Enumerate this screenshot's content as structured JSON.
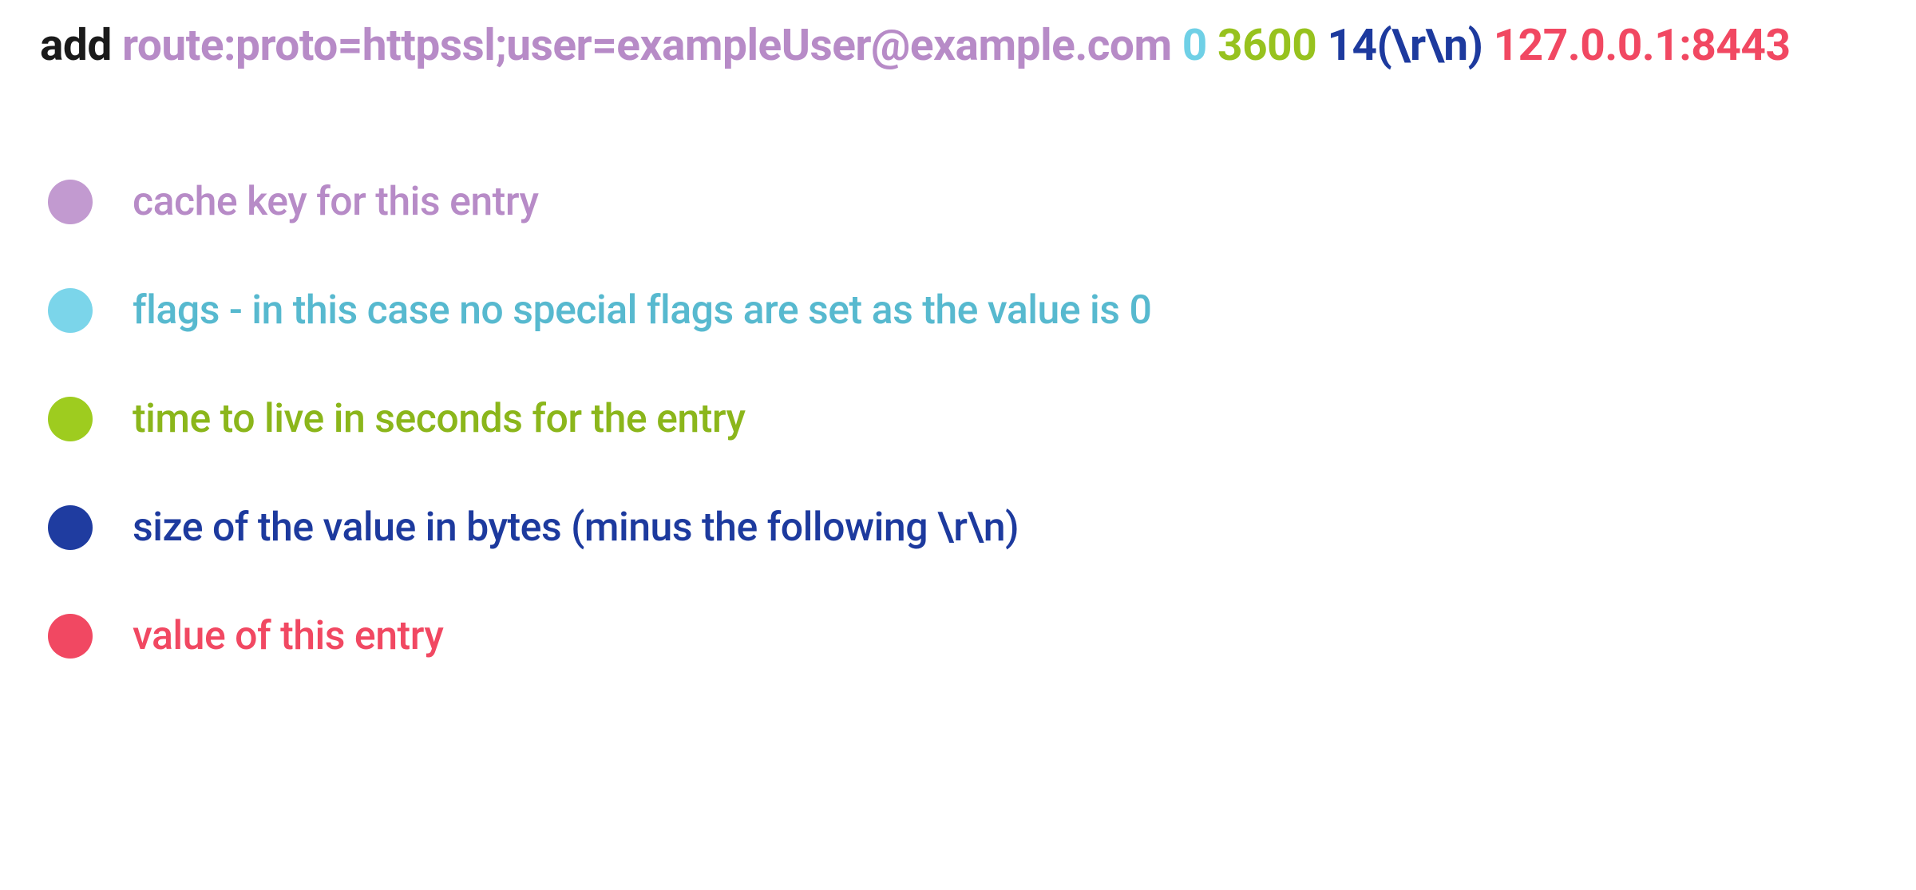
{
  "command": {
    "action": "add",
    "key": "route:proto=httpssl;user=exampleUser@example.com",
    "flags": "0",
    "ttl": "3600",
    "size": "14(\\r\\n)",
    "value": "127.0.0.1:8443"
  },
  "legend": {
    "key": "cache key for this entry",
    "flags": "flags - in this case no special flags are set as the value is 0",
    "ttl": "time to live in seconds for the entry",
    "size": "size of the value in bytes (minus the following \\r\\n)",
    "value": "value of this entry"
  },
  "colors": {
    "key": "#b78bc7",
    "flags": "#6fd0e6",
    "ttl": "#97c21e",
    "size": "#1d3a9e",
    "value": "#f14862"
  }
}
